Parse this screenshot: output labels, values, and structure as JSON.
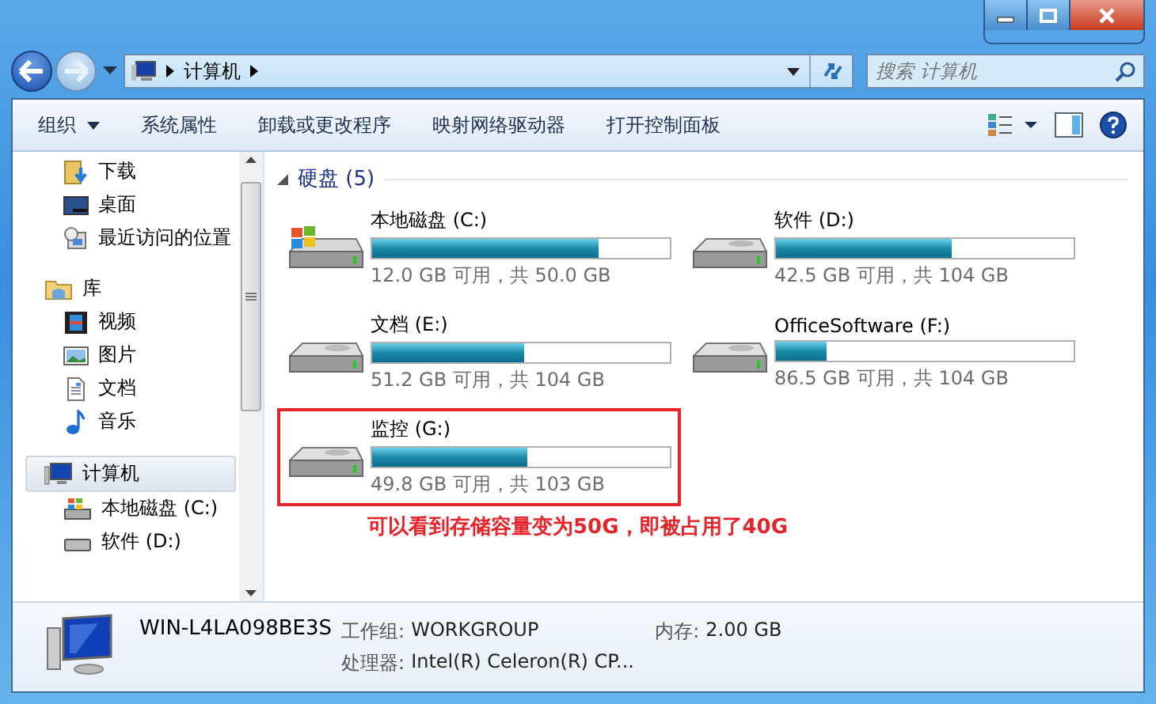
{
  "address_bar": {
    "crumbs": [
      "计算机"
    ]
  },
  "search": {
    "placeholder": "搜索 计算机"
  },
  "toolbar": {
    "buttons": [
      {
        "label": "组织",
        "dropdown": true
      },
      {
        "label": "系统属性",
        "dropdown": false
      },
      {
        "label": "卸载或更改程序",
        "dropdown": false
      },
      {
        "label": "映射网络驱动器",
        "dropdown": false
      },
      {
        "label": "打开控制面板",
        "dropdown": false
      }
    ]
  },
  "sidebar": {
    "groups": [
      {
        "children": [
          {
            "label": "下载",
            "kind": "download",
            "selected": false
          },
          {
            "label": "桌面",
            "kind": "desktop",
            "selected": false
          },
          {
            "label": "最近访问的位置",
            "kind": "recent",
            "selected": false
          }
        ]
      },
      {
        "label": "库",
        "kind": "library",
        "selected": false,
        "children": [
          {
            "label": "视频",
            "kind": "video",
            "selected": false
          },
          {
            "label": "图片",
            "kind": "picture",
            "selected": false
          },
          {
            "label": "文档",
            "kind": "document",
            "selected": false
          },
          {
            "label": "音乐",
            "kind": "music",
            "selected": false
          }
        ]
      },
      {
        "label": "计算机",
        "kind": "computer",
        "selected": true,
        "children": [
          {
            "label": "本地磁盘 (C:)",
            "kind": "system",
            "selected": false
          },
          {
            "label": "软件 (D:)",
            "kind": "disk",
            "selected": false
          }
        ]
      }
    ]
  },
  "section": {
    "title": "硬盘 (5)",
    "expanded": true
  },
  "drives": [
    {
      "name": "本地磁盘 (C:)",
      "kind": "system",
      "level": 0.76,
      "free": "12.0 GB 可用，共 50.0 GB",
      "highlighted": false
    },
    {
      "name": "软件 (D:)",
      "kind": "disk",
      "level": 0.59,
      "free": "42.5 GB 可用，共 104 GB",
      "highlighted": false
    },
    {
      "name": "文档 (E:)",
      "kind": "disk",
      "level": 0.51,
      "free": "51.2 GB 可用，共 104 GB",
      "highlighted": false
    },
    {
      "name": "OfficeSoftware (F:)",
      "kind": "disk",
      "level": 0.17,
      "free": "86.5 GB 可用，共 104 GB",
      "highlighted": false
    },
    {
      "name": "监控 (G:)",
      "kind": "disk",
      "level": 0.52,
      "free": "49.8 GB 可用，共 103 GB",
      "highlighted": true
    }
  ],
  "annotation": "可以看到存储容量变为50G，即被占用了40G",
  "details": {
    "name": "WIN-L4LA098BE3S",
    "fields": [
      {
        "label": "工作组:",
        "value": "WORKGROUP"
      },
      {
        "label": "内存:",
        "value": "2.00 GB"
      },
      {
        "label": "处理器:",
        "value": "Intel(R) Celeron(R) CP..."
      }
    ]
  }
}
